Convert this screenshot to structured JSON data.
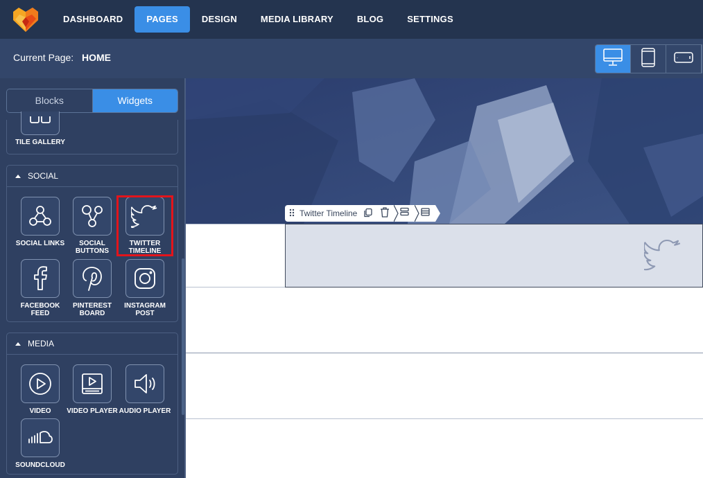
{
  "nav": {
    "items": [
      {
        "label": "DASHBOARD",
        "active": false
      },
      {
        "label": "PAGES",
        "active": true
      },
      {
        "label": "DESIGN",
        "active": false
      },
      {
        "label": "MEDIA LIBRARY",
        "active": false
      },
      {
        "label": "BLOG",
        "active": false
      },
      {
        "label": "SETTINGS",
        "active": false
      }
    ]
  },
  "subheader": {
    "current_page_label": "Current Page:",
    "current_page_value": "HOME",
    "devices": [
      "desktop-icon",
      "tablet-icon",
      "mobile-landscape-icon"
    ]
  },
  "sidebar": {
    "tabs": [
      {
        "label": "Blocks",
        "active": false
      },
      {
        "label": "Widgets",
        "active": true
      }
    ],
    "partial_widget": {
      "label": "TILE GALLERY",
      "icon": "tile-gallery-icon"
    },
    "social": {
      "title": "SOCIAL",
      "widgets": [
        {
          "label": "SOCIAL LINKS",
          "icon": "social-links-icon"
        },
        {
          "label": "SOCIAL BUTTONS",
          "icon": "social-buttons-icon"
        },
        {
          "label": "TWITTER TIMELINE",
          "icon": "twitter-icon"
        },
        {
          "label": "FACEBOOK FEED",
          "icon": "facebook-icon"
        },
        {
          "label": "PINTEREST BOARD",
          "icon": "pinterest-icon"
        },
        {
          "label": "INSTAGRAM POST",
          "icon": "instagram-icon"
        }
      ]
    },
    "media": {
      "title": "MEDIA",
      "widgets": [
        {
          "label": "VIDEO",
          "icon": "video-icon"
        },
        {
          "label": "VIDEO PLAYER",
          "icon": "video-player-icon"
        },
        {
          "label": "AUDIO PLAYER",
          "icon": "audio-player-icon"
        },
        {
          "label": "SOUNDCLOUD",
          "icon": "soundcloud-icon"
        }
      ]
    }
  },
  "canvas": {
    "toolbar_label": "Twitter Timeline",
    "toolbar_icons": [
      "drag-handle-icon",
      "copy-icon",
      "delete-icon",
      "row-icon",
      "section-icon"
    ]
  },
  "colors": {
    "nav_bg": "#24344f",
    "subheader_bg": "#33466a",
    "sidebar_bg": "#2f4061",
    "accent": "#3a8ee6",
    "highlight": "#e3141b"
  }
}
